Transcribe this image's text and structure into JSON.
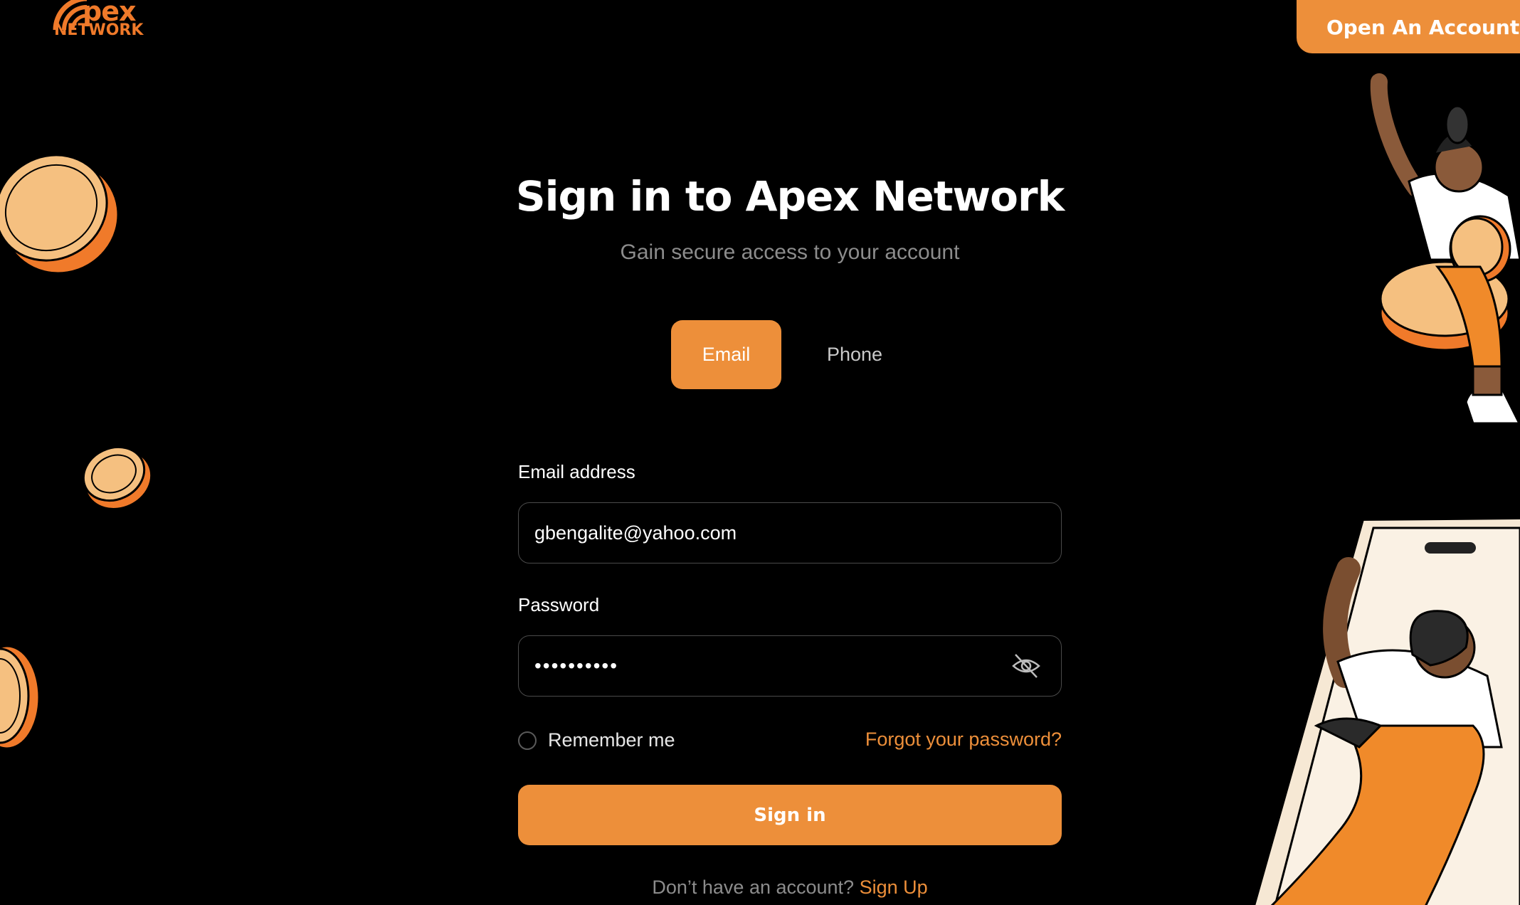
{
  "brand": {
    "logo_word": "pex",
    "logo_sub": "NETWORK"
  },
  "header": {
    "open_account_label": "Open An Account"
  },
  "main": {
    "title": "Sign in to Apex Network",
    "subtitle": "Gain secure access to your account",
    "tabs": [
      {
        "label": "Email",
        "active": true
      },
      {
        "label": "Phone",
        "active": false
      }
    ],
    "email": {
      "label": "Email address",
      "value": "gbengalite@yahoo.com"
    },
    "password": {
      "label": "Password",
      "masked_value": "••••••••••"
    },
    "remember_label": "Remember me",
    "forgot_label": "Forgot your password?",
    "signin_label": "Sign in",
    "signup_prompt": "Don’t have an account?",
    "signup_link": "Sign Up"
  },
  "colors": {
    "background": "#000000",
    "accent": "#ed8f3a",
    "muted_text": "#8c8c8c",
    "field_border": "#4a4a4a"
  },
  "icons": {
    "logo": "wifi-signal-logo-icon",
    "password_toggle": "eye-off-icon",
    "decor": [
      "coin-illustration",
      "person-on-coins-illustration",
      "person-climbing-phone-illustration"
    ]
  }
}
